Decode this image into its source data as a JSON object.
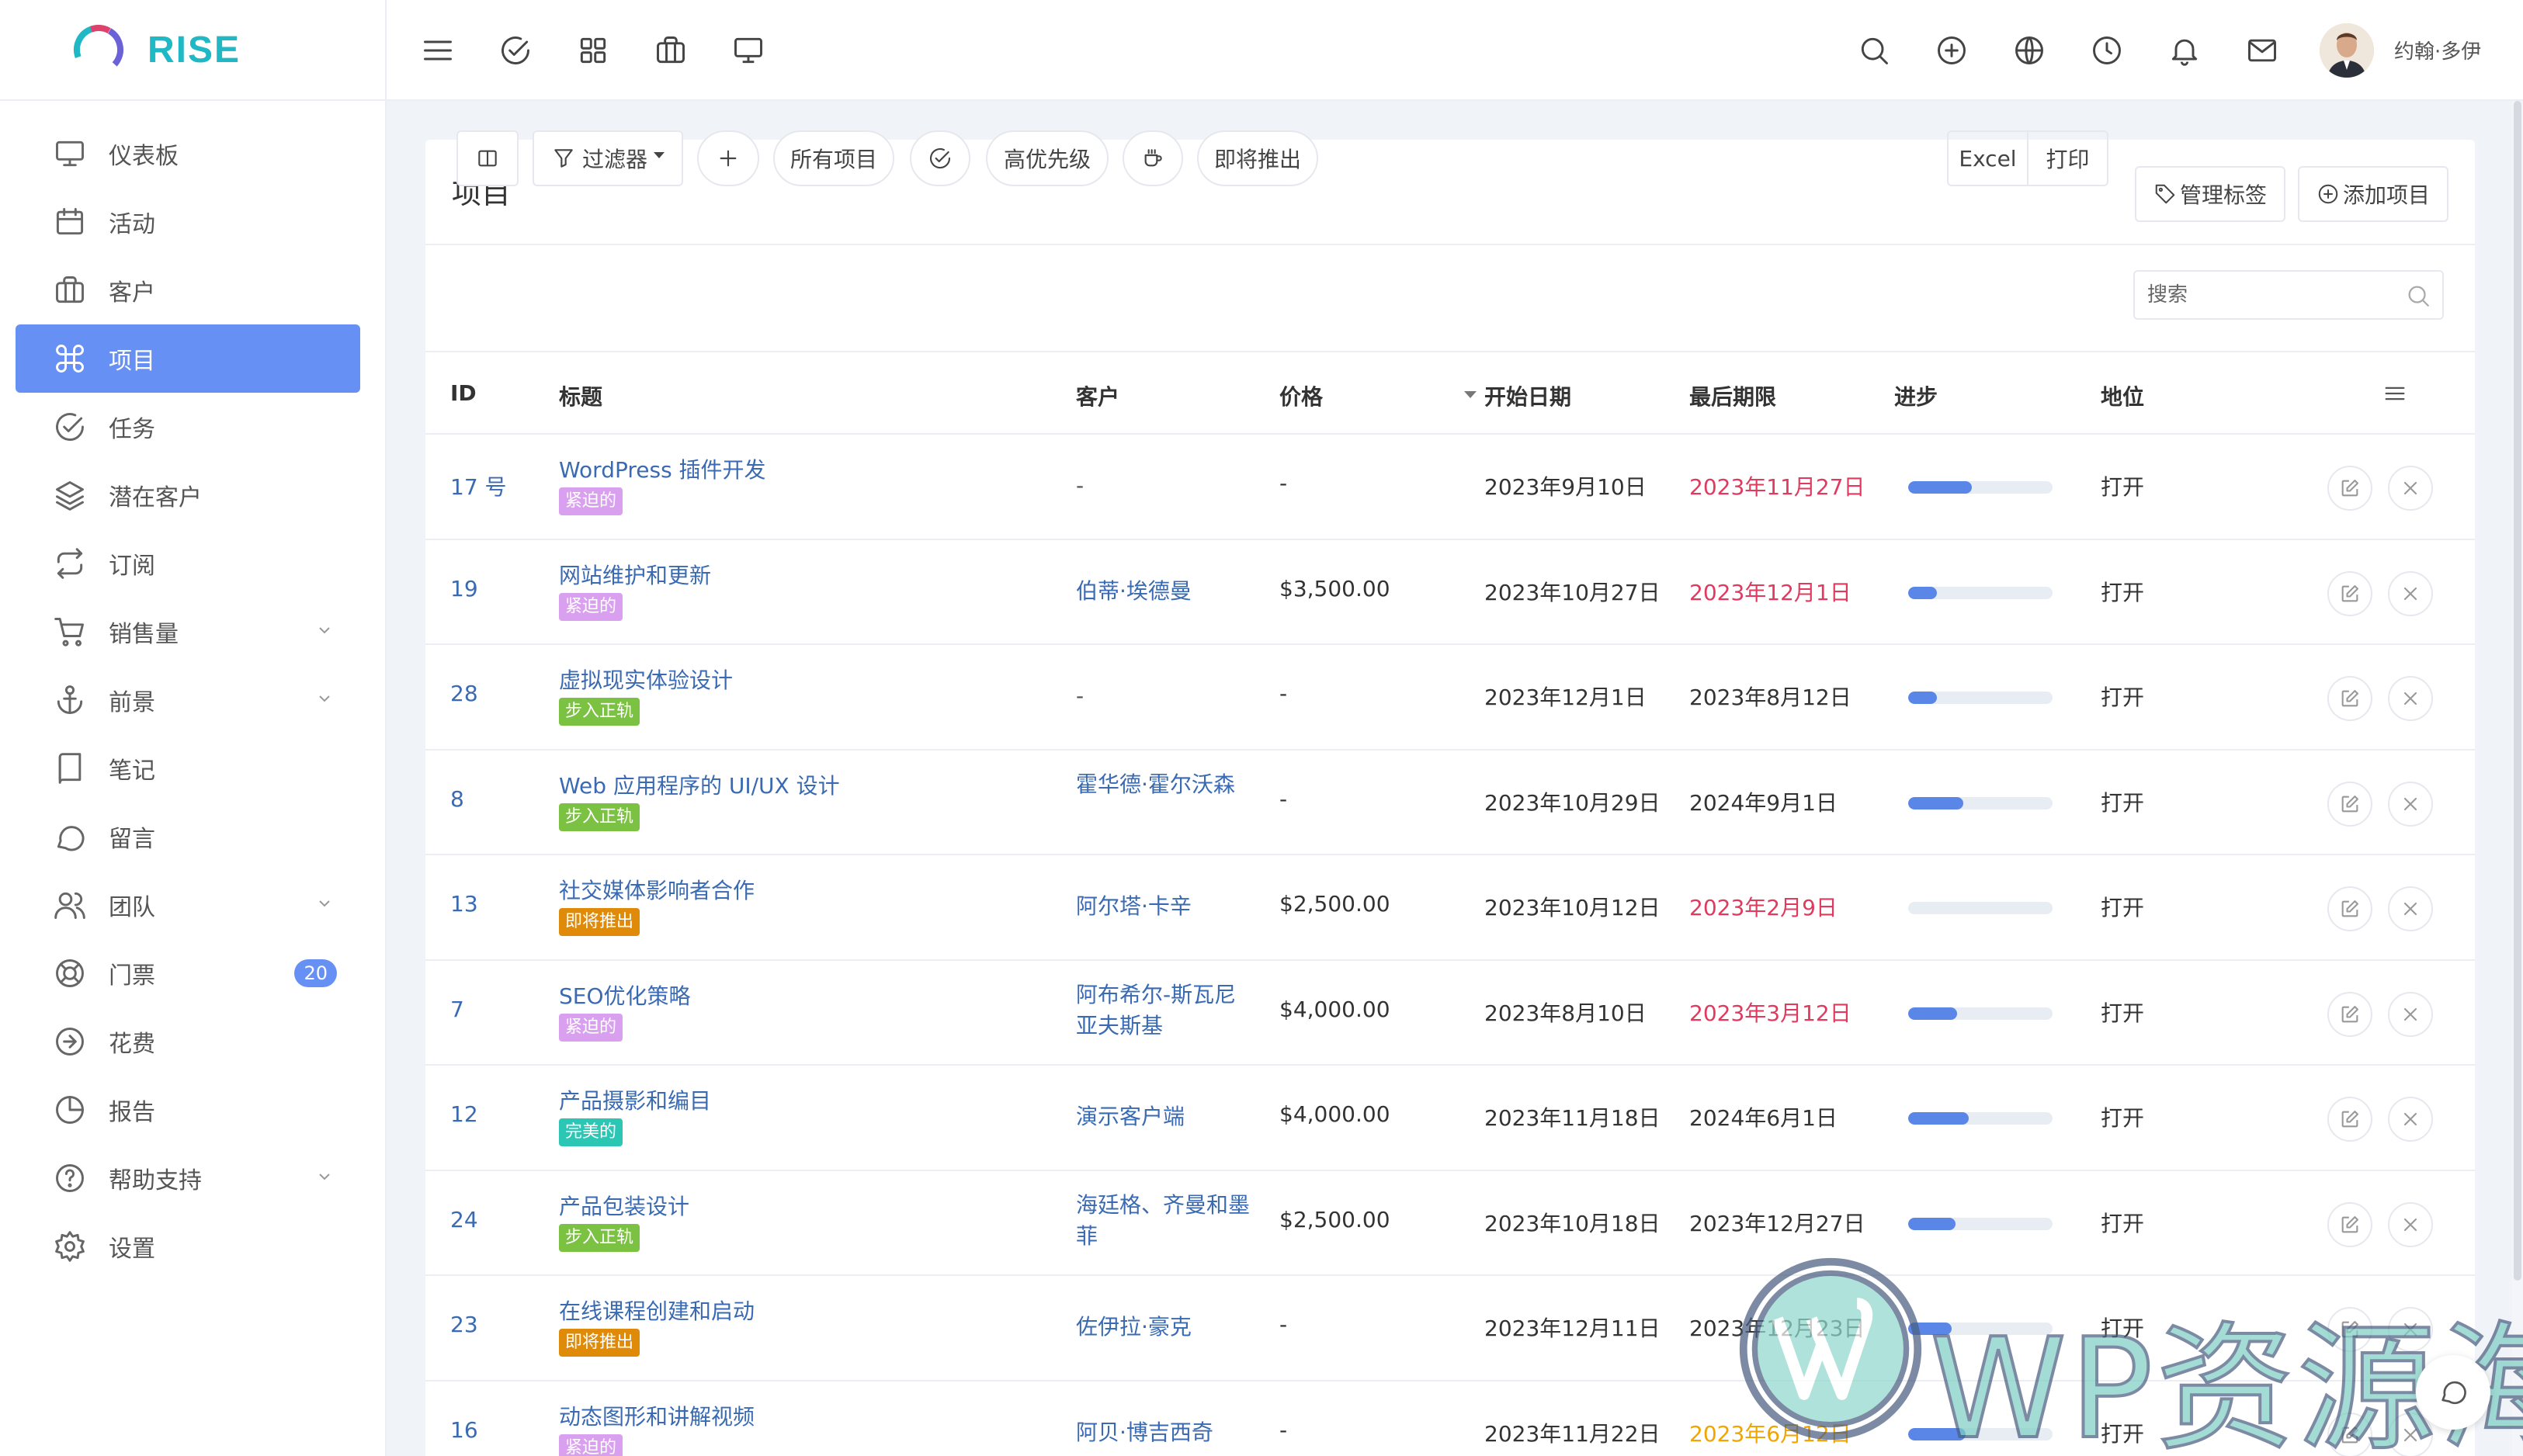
{
  "brand": {
    "name": "RISE"
  },
  "sidebar": {
    "items": [
      {
        "label": "仪表板",
        "icon": "monitor-icon"
      },
      {
        "label": "活动",
        "icon": "calendar-icon"
      },
      {
        "label": "客户",
        "icon": "briefcase-icon"
      },
      {
        "label": "项目",
        "icon": "command-icon",
        "active": true
      },
      {
        "label": "任务",
        "icon": "check-circle-icon"
      },
      {
        "label": "潜在客户",
        "icon": "layers-icon"
      },
      {
        "label": "订阅",
        "icon": "repeat-icon"
      },
      {
        "label": "销售量",
        "icon": "cart-icon",
        "expandable": true
      },
      {
        "label": "前景",
        "icon": "anchor-icon",
        "expandable": true
      },
      {
        "label": "笔记",
        "icon": "book-icon"
      },
      {
        "label": "留言",
        "icon": "message-icon"
      },
      {
        "label": "团队",
        "icon": "users-icon",
        "expandable": true
      },
      {
        "label": "门票",
        "icon": "lifebuoy-icon",
        "badge": "20"
      },
      {
        "label": "花费",
        "icon": "arrow-circle-icon"
      },
      {
        "label": "报告",
        "icon": "pie-chart-icon"
      },
      {
        "label": "帮助支持",
        "icon": "help-circle-icon",
        "expandable": true
      },
      {
        "label": "设置",
        "icon": "settings-icon"
      }
    ]
  },
  "topbar": {
    "user_name": "约翰·多伊",
    "left_icons": [
      "menu-icon",
      "check-circle-icon",
      "grid-icon",
      "briefcase-icon",
      "monitor-icon"
    ],
    "right_icons": [
      "search-icon",
      "plus-circle-icon",
      "globe-icon",
      "clock-icon",
      "bell-icon",
      "mail-icon"
    ]
  },
  "page": {
    "title": "项目",
    "manage_labels": "管理标签",
    "add_project": "添加项目"
  },
  "toolbar": {
    "filter": "过滤器",
    "all_projects": "所有项目",
    "high_priority": "高优先级",
    "coming_soon": "即将推出",
    "excel": "Excel",
    "print": "打印",
    "search_placeholder": "搜索"
  },
  "table": {
    "columns": [
      "ID",
      "标题",
      "客户",
      "价格",
      "开始日期",
      "最后期限",
      "进步",
      "地位"
    ],
    "rows": [
      {
        "id": "17 号",
        "title": "WordPress 插件开发",
        "label": "紧迫的",
        "label_color": "#d9a0f0",
        "client": "-",
        "price": "-",
        "start": "2023年9月10日",
        "deadline": "2023年11月27日",
        "deadline_state": "overdue",
        "progress": 0.44,
        "status": "打开"
      },
      {
        "id": "19",
        "title": "网站维护和更新",
        "label": "紧迫的",
        "label_color": "#d9a0f0",
        "client": "伯蒂·埃德曼",
        "price": "$3,500.00",
        "start": "2023年10月27日",
        "deadline": "2023年12月1日",
        "deadline_state": "overdue",
        "progress": 0.2,
        "status": "打开"
      },
      {
        "id": "28",
        "title": "虚拟现实体验设计",
        "label": "步入正轨",
        "label_color": "#7cc242",
        "client": "-",
        "price": "-",
        "start": "2023年12月1日",
        "deadline": "2023年8月12日",
        "deadline_state": "normal",
        "progress": 0.2,
        "status": "打开"
      },
      {
        "id": "8",
        "title": "Web 应用程序的 UI/UX 设计",
        "label": "步入正轨",
        "label_color": "#7cc242",
        "client": "霍华德·霍尔沃森",
        "price": "-",
        "start": "2023年10月29日",
        "deadline": "2024年9月1日",
        "deadline_state": "normal",
        "progress": 0.38,
        "status": "打开"
      },
      {
        "id": "13",
        "title": "社交媒体影响者合作",
        "label": "即将推出",
        "label_color": "#e08a0a",
        "client": "阿尔塔·卡辛",
        "price": "$2,500.00",
        "start": "2023年10月12日",
        "deadline": "2023年2月9日",
        "deadline_state": "overdue",
        "progress": 0,
        "status": "打开"
      },
      {
        "id": "7",
        "title": "SEO优化策略",
        "label": "紧迫的",
        "label_color": "#d9a0f0",
        "client": "阿布希尔-斯瓦尼亚夫斯基",
        "price": "$4,000.00",
        "start": "2023年8月10日",
        "deadline": "2023年3月12日",
        "deadline_state": "overdue",
        "progress": 0.34,
        "status": "打开"
      },
      {
        "id": "12",
        "title": "产品摄影和编目",
        "label": "完美的",
        "label_color": "#2cc6b4",
        "client": "演示客户端",
        "price": "$4,000.00",
        "start": "2023年11月18日",
        "deadline": "2024年6月1日",
        "deadline_state": "normal",
        "progress": 0.42,
        "status": "打开"
      },
      {
        "id": "24",
        "title": "产品包装设计",
        "label": "步入正轨",
        "label_color": "#7cc242",
        "client": "海廷格、齐曼和墨菲",
        "price": "$2,500.00",
        "start": "2023年10月18日",
        "deadline": "2023年12月27日",
        "deadline_state": "normal",
        "progress": 0.33,
        "status": "打开"
      },
      {
        "id": "23",
        "title": "在线课程创建和启动",
        "label": "即将推出",
        "label_color": "#e08a0a",
        "client": "佐伊拉·豪克",
        "price": "-",
        "start": "2023年12月11日",
        "deadline": "2023年12月23日",
        "deadline_state": "normal",
        "progress": 0.3,
        "status": "打开"
      },
      {
        "id": "16",
        "title": "动态图形和讲解视频",
        "label": "紧迫的",
        "label_color": "#d9a0f0",
        "client": "阿贝·博吉西奇",
        "price": "-",
        "start": "2023年11月22日",
        "deadline": "2023年6月12日",
        "deadline_state": "soon",
        "progress": 0.4,
        "status": "打开"
      }
    ]
  },
  "watermark": {
    "text": "WP资源海"
  },
  "colors": {
    "accent": "#6690f4",
    "brand": "#1fb8c4",
    "link": "#3a6ab2",
    "overdue": "#e03a5f"
  }
}
